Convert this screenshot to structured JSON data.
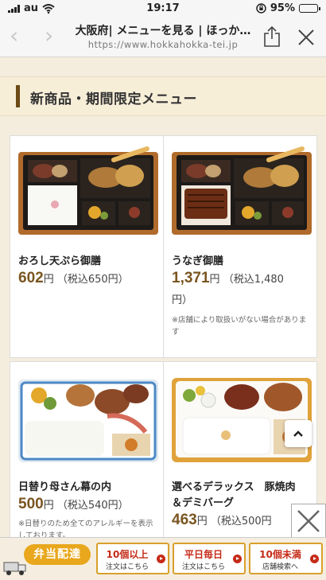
{
  "status": {
    "carrier": "au",
    "time": "19:17",
    "battery": "95%",
    "battery_level": 0.95
  },
  "browser": {
    "title": "大阪府| メニューを見る | ほっか…",
    "url": "https://www.hokkahokka-tei.jp"
  },
  "section": {
    "title": "新商品・期間限定メニュー"
  },
  "products": [
    {
      "name": "おろし天ぷら御膳",
      "price": "602",
      "yen": "円",
      "tax": "（税込650円）",
      "note": ""
    },
    {
      "name": "うなぎ御膳",
      "price": "1,371",
      "yen": "円",
      "tax": "（税込1,480",
      "tax2": "円）",
      "note": "※店舗により取扱いがない場合があります"
    },
    {
      "name": "日替り母さん幕の内",
      "price": "500",
      "yen": "円",
      "tax": "（税込540円）",
      "note": "※日替りのため全てのアレルギーを表示しております。"
    },
    {
      "name": "選べるデラックス　豚焼肉",
      "name2": "＆デミバーグ",
      "price": "463",
      "yen": "円",
      "tax": "（税込500円"
    }
  ],
  "bottom_banner": {
    "delivery_label": "弁当配達",
    "items": [
      {
        "line1": "10個以上",
        "line2": "注文はこちら"
      },
      {
        "line1": "平日毎日",
        "line2": "注文はこちら"
      },
      {
        "line1": "10個未満",
        "line2": "店舗検索へ"
      }
    ]
  },
  "colors": {
    "accent_brown": "#7a5520",
    "banner_red": "#c52a17",
    "banner_gold": "#d9a02b"
  }
}
